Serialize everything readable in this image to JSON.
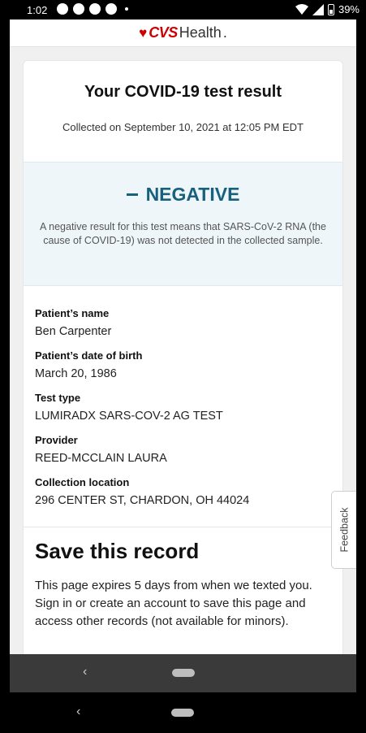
{
  "status_bar": {
    "time": "1:02",
    "battery": "39%"
  },
  "header": {
    "logo_brand": "CVS",
    "logo_suffix": "Health",
    "logo_suffix_mark": "."
  },
  "result": {
    "title": "Your COVID-19 test result",
    "collected": "Collected on September 10, 2021 at 12:05 PM EDT",
    "status": "NEGATIVE",
    "explanation": "A negative result for this test means that SARS-CoV-2 RNA (the cause of COVID-19) was not detected in the collected sample."
  },
  "details": {
    "patient_name_label": "Patient’s name",
    "patient_name": "Ben Carpenter",
    "dob_label": "Patient’s date of birth",
    "dob": "March 20, 1986",
    "test_type_label": "Test type",
    "test_type": "LUMIRADX SARS-COV-2 AG TEST",
    "provider_label": "Provider",
    "provider": "REED-MCCLAIN LAURA",
    "location_label": "Collection location",
    "location": "296 CENTER ST, CHARDON, OH 44024"
  },
  "save": {
    "title": "Save this record",
    "text": "This page expires 5 days from when we texted you. Sign in or create an account to save this page and access other records (not available for minors)."
  },
  "feedback": {
    "label": "Feedback"
  },
  "colors": {
    "brand_red": "#cc0000",
    "negative_teal": "#17607e"
  },
  "icons": {
    "status_left": [
      "messenger-icon",
      "facebook-icon",
      "shield-app-icon",
      "facebook-icon"
    ],
    "status_right": [
      "wifi-icon",
      "signal-icon",
      "battery-icon"
    ]
  }
}
